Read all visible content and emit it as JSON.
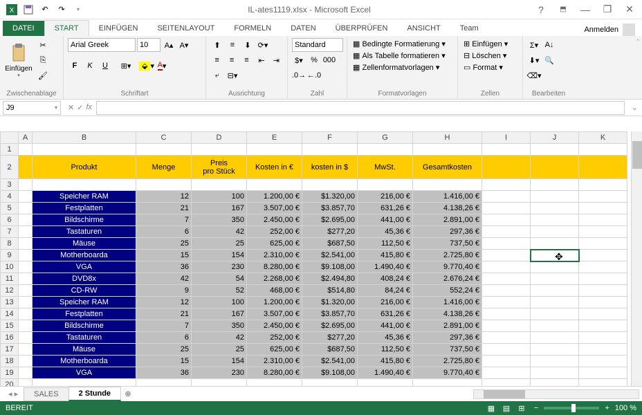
{
  "title": "IL-ates1119.xlsx - Microsoft Excel",
  "tabs": [
    "DATEI",
    "START",
    "EINFÜGEN",
    "SEITENLAYOUT",
    "FORMELN",
    "DATEN",
    "ÜBERPRÜFEN",
    "ANSICHT",
    "Team"
  ],
  "login": "Anmelden",
  "ribbon": {
    "clipboard": {
      "paste": "Einfügen",
      "label": "Zwischenablage"
    },
    "font": {
      "name": "Arial Greek",
      "size": "10",
      "label": "Schriftart",
      "bold": "F",
      "italic": "K",
      "underline": "U"
    },
    "alignment": {
      "label": "Ausrichtung"
    },
    "number": {
      "format": "Standard",
      "label": "Zahl"
    },
    "styles": {
      "cond": "Bedingte Formatierung",
      "table": "Als Tabelle formatieren",
      "cell": "Zellenformatvorlagen",
      "label": "Formatvorlagen"
    },
    "cells": {
      "insert": "Einfügen",
      "delete": "Löschen",
      "format": "Format",
      "label": "Zellen"
    },
    "editing": {
      "label": "Bearbeiten"
    }
  },
  "name_box": "J9",
  "columns": [
    "A",
    "B",
    "C",
    "D",
    "E",
    "F",
    "G",
    "H",
    "I",
    "J",
    "K"
  ],
  "header": {
    "produkt": "Produkt",
    "menge": "Menge",
    "preis": "Preis\npro Stück",
    "kosten_e": "Kosten in €",
    "kosten_d": "kosten in $",
    "mwst": "MwSt.",
    "gesamt": "Gesamtkosten"
  },
  "rows": [
    {
      "n": 4,
      "p": "Speicher RAM",
      "m": "12",
      "ps": "100",
      "ke": "1.200,00 €",
      "kd": "$1.320,00",
      "mw": "216,00 €",
      "g": "1.416,00 €"
    },
    {
      "n": 5,
      "p": "Festplatten",
      "m": "21",
      "ps": "167",
      "ke": "3.507,00 €",
      "kd": "$3.857,70",
      "mw": "631,26 €",
      "g": "4.138,26 €"
    },
    {
      "n": 6,
      "p": "Bildschirme",
      "m": "7",
      "ps": "350",
      "ke": "2.450,00 €",
      "kd": "$2.695,00",
      "mw": "441,00 €",
      "g": "2.891,00 €"
    },
    {
      "n": 7,
      "p": "Tastaturen",
      "m": "6",
      "ps": "42",
      "ke": "252,00 €",
      "kd": "$277,20",
      "mw": "45,36 €",
      "g": "297,36 €"
    },
    {
      "n": 8,
      "p": "Mäuse",
      "m": "25",
      "ps": "25",
      "ke": "625,00 €",
      "kd": "$687,50",
      "mw": "112,50 €",
      "g": "737,50 €"
    },
    {
      "n": 9,
      "p": "Motherboarda",
      "m": "15",
      "ps": "154",
      "ke": "2.310,00 €",
      "kd": "$2.541,00",
      "mw": "415,80 €",
      "g": "2.725,80 €"
    },
    {
      "n": 10,
      "p": "VGA",
      "m": "36",
      "ps": "230",
      "ke": "8.280,00 €",
      "kd": "$9.108,00",
      "mw": "1.490,40 €",
      "g": "9.770,40 €"
    },
    {
      "n": 11,
      "p": "DVD8x",
      "m": "42",
      "ps": "54",
      "ke": "2.268,00 €",
      "kd": "$2.494,80",
      "mw": "408,24 €",
      "g": "2.676,24 €"
    },
    {
      "n": 12,
      "p": "CD-RW",
      "m": "9",
      "ps": "52",
      "ke": "468,00 €",
      "kd": "$514,80",
      "mw": "84,24 €",
      "g": "552,24 €"
    },
    {
      "n": 13,
      "p": "Speicher RAM",
      "m": "12",
      "ps": "100",
      "ke": "1.200,00 €",
      "kd": "$1.320,00",
      "mw": "216,00 €",
      "g": "1.416,00 €"
    },
    {
      "n": 14,
      "p": "Festplatten",
      "m": "21",
      "ps": "167",
      "ke": "3.507,00 €",
      "kd": "$3.857,70",
      "mw": "631,26 €",
      "g": "4.138,26 €"
    },
    {
      "n": 15,
      "p": "Bildschirme",
      "m": "7",
      "ps": "350",
      "ke": "2.450,00 €",
      "kd": "$2.695,00",
      "mw": "441,00 €",
      "g": "2.891,00 €"
    },
    {
      "n": 16,
      "p": "Tastaturen",
      "m": "6",
      "ps": "42",
      "ke": "252,00 €",
      "kd": "$277,20",
      "mw": "45,36 €",
      "g": "297,36 €"
    },
    {
      "n": 17,
      "p": "Mäuse",
      "m": "25",
      "ps": "25",
      "ke": "625,00 €",
      "kd": "$687,50",
      "mw": "112,50 €",
      "g": "737,50 €"
    },
    {
      "n": 18,
      "p": "Motherboarda",
      "m": "15",
      "ps": "154",
      "ke": "2.310,00 €",
      "kd": "$2.541,00",
      "mw": "415,80 €",
      "g": "2.725,80 €"
    },
    {
      "n": 19,
      "p": "VGA",
      "m": "36",
      "ps": "230",
      "ke": "8.280,00 €",
      "kd": "$9.108,00",
      "mw": "1.490,40 €",
      "g": "9.770,40 €"
    }
  ],
  "sheets": {
    "s1": "SALES",
    "s2": "2 Stunde"
  },
  "status": "BEREIT",
  "zoom": "100 %"
}
